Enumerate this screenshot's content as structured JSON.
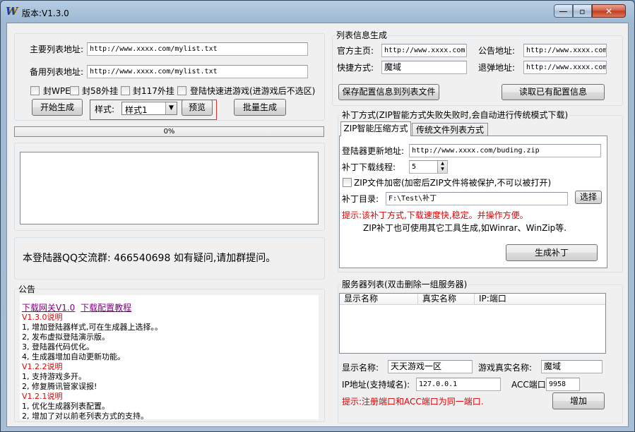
{
  "window": {
    "title": "版本:V1.3.0",
    "app_icon": "W",
    "min": "—",
    "max": "▫",
    "close": "✕"
  },
  "left": {
    "main_list_label": "主要列表地址:",
    "main_list_value": "http://www.xxxx.com/mylist.txt",
    "backup_list_label": "备用列表地址:",
    "backup_list_value": "http://www.xxxx.com/mylist.txt",
    "checkboxes": [
      "封WPE",
      "封58外挂",
      "封117外挂",
      "登陆快速进游戏(进游戏后不选区)"
    ],
    "start_button": "开始生成",
    "style_label": "样式:",
    "style_value": "样式1",
    "preview_button": "预览",
    "batch_button": "批量生成",
    "progress_text": "0%",
    "progress_value": 0,
    "qq_text": "本登陆器QQ交流群: 466540698 如有疑问,请加群提问。",
    "notice_title": "公告",
    "notice_links": [
      "下载网关V1.0",
      "下载配置教程"
    ],
    "notice_lines": [
      {
        "text": "V1.3.0说明",
        "type": "red"
      },
      {
        "text": "1, 增加登陆器样式,可在生成器上选择。。",
        "type": "normal"
      },
      {
        "text": "2, 发布虚拟登陆演示版。",
        "type": "normal"
      },
      {
        "text": "3, 登陆器代码优化。",
        "type": "normal"
      },
      {
        "text": "4, 生成器增加自动更新功能。",
        "type": "normal"
      },
      {
        "text": "V1.2.2说明",
        "type": "red"
      },
      {
        "text": "1, 支持游戏多开。",
        "type": "normal"
      },
      {
        "text": "2, 修复腾讯管家误报!",
        "type": "normal"
      },
      {
        "text": "V1.2.1说明",
        "type": "red"
      },
      {
        "text": "1, 优化生成器列表配置。",
        "type": "normal"
      },
      {
        "text": "2, 增加了对以前老列表方式的支持。",
        "type": "normal"
      }
    ]
  },
  "list_info": {
    "title": "列表信息生成",
    "official_label": "官方主页:",
    "official_value": "http://www.xxxx.com",
    "notice_addr_label": "公告地址:",
    "notice_addr_value": "http://www.xxxx.com",
    "shortcut_label": "快捷方式:",
    "shortcut_value": "魔域",
    "bounce_label": "退弹地址:",
    "bounce_value": "http://www.xxxx.com",
    "save_button": "保存配置信息到列表文件",
    "read_button": "读取已有配置信息"
  },
  "patch": {
    "title": "补丁方式(ZIP智能方式失败失败时,会自动进行传统模式下载)",
    "tabs": [
      "ZIP智能压缩方式",
      "传统文件列表方式"
    ],
    "update_label": "登陆器更新地址:",
    "update_value": "http://www.xxxx.com/buding.zip",
    "threads_label": "补丁下载线程:",
    "threads_value": "5",
    "encrypt_label": "ZIP文件加密(加密后ZIP文件将被保护,不可以被打开)",
    "dir_label": "补丁目录:",
    "dir_value": "F:\\Test\\补丁",
    "choose_button": "选择",
    "tip_red": "提示:该补丁方式,下载速度快,稳定。并操作方便。",
    "tip_normal": "ZIP补丁也可使用其它工具生成,如Winrar、WinZip等.",
    "generate_button": "生成补丁"
  },
  "servers": {
    "title": "服务器列表(双击删除一组服务器)",
    "columns": [
      "显示名称",
      "真实名称",
      "IP:端口"
    ],
    "display_label": "显示名称:",
    "display_value": "天天游戏一区",
    "real_label": "游戏真实名称:",
    "real_value": "魔域",
    "ip_label": "IP地址(支持域名):",
    "ip_value": "127.0.0.1",
    "acc_label": "ACC端口:",
    "acc_value": "9958",
    "tip": "提示:注册端口和ACC端口为同一端口.",
    "add_button": "增加"
  },
  "colors": {
    "accent_red": "#e00000",
    "link_purple": "#800080",
    "highlight_border": "#e03030"
  }
}
